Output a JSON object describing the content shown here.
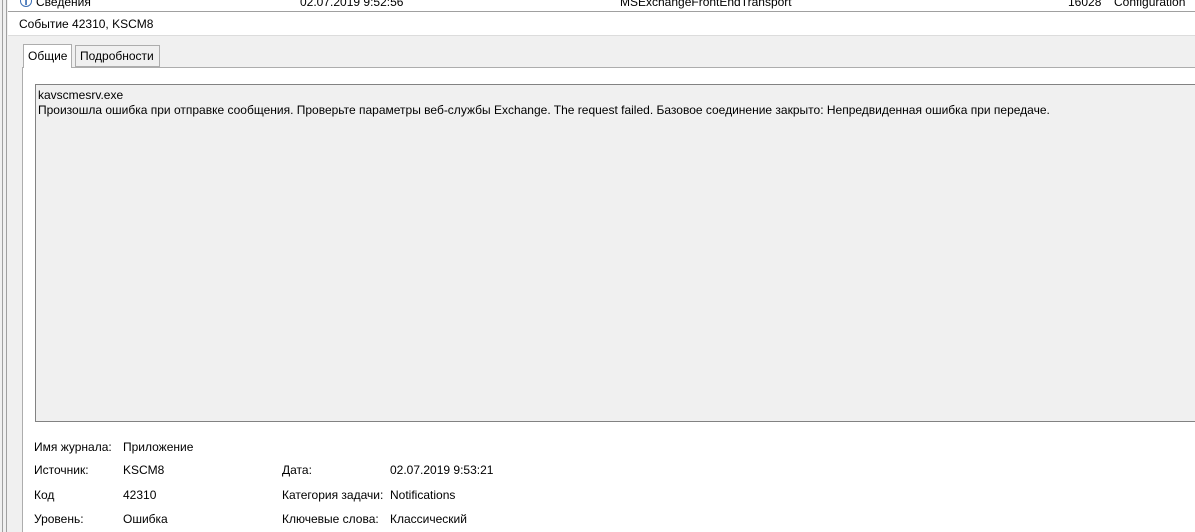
{
  "list_row": {
    "level": "Сведения",
    "datetime": "02.07.2019 9:52:56",
    "source": "MSExchangeFrontEndTransport",
    "event_id": "16028",
    "category": "Configuration"
  },
  "event_title": "Событие 42310, KSCM8",
  "tabs": [
    {
      "label": "Общие"
    },
    {
      "label": "Подробности"
    }
  ],
  "message": {
    "line1": "kavscmesrv.exe",
    "line2": "Произошла ошибка при отправке сообщения. Проверьте параметры веб-службы Exchange. The request failed. Базовое соединение закрыто: Непредвиденная ошибка при передаче."
  },
  "properties": {
    "log_name_label": "Имя журнала:",
    "log_name_value": "Приложение",
    "source_label": "Источник:",
    "source_value": "KSCM8",
    "date_label": "Дата:",
    "date_value": "02.07.2019 9:53:21",
    "code_label": "Код",
    "code_value": "42310",
    "task_category_label": "Категория задачи:",
    "task_category_value": "Notifications",
    "level_label": "Уровень:",
    "level_value": "Ошибка",
    "keywords_label": "Ключевые слова:",
    "keywords_value": "Классический"
  },
  "icons": {
    "row_level_icon": "info-icon"
  }
}
